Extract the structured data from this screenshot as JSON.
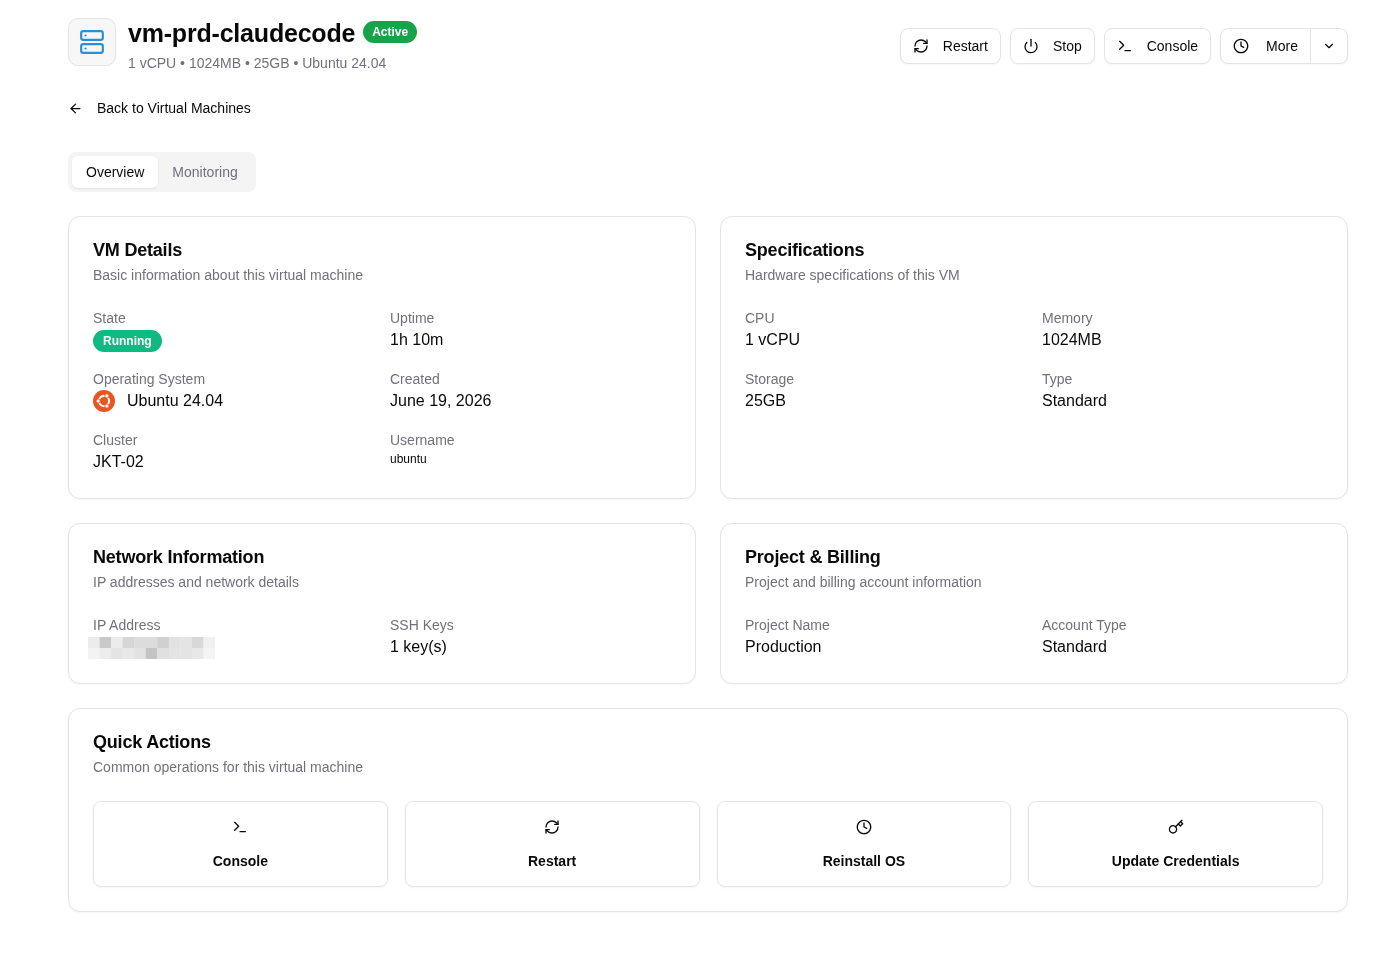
{
  "header": {
    "title": "vm-prd-claudecode",
    "status_badge": "Active",
    "subtitle": "1 vCPU • 1024MB • 25GB • Ubuntu 24.04"
  },
  "actions": [
    {
      "kind": "restart",
      "label": "Restart"
    },
    {
      "kind": "stop",
      "label": "Stop"
    },
    {
      "kind": "console",
      "label": "Console"
    },
    {
      "kind": "more",
      "label": "More"
    }
  ],
  "back_link": "Back to Virtual Machines",
  "tabs": [
    {
      "label": "Overview",
      "selected": true
    },
    {
      "label": "Monitoring",
      "selected": false
    }
  ],
  "cards": [
    {
      "title": "VM Details",
      "description": "Basic information about this virtual machine",
      "fields": [
        {
          "kind": "badge",
          "label": "State",
          "value": "Running"
        },
        {
          "kind": "text",
          "label": "Uptime",
          "value": "1h 10m"
        },
        {
          "kind": "os",
          "label": "Operating System",
          "value": "Ubuntu 24.04"
        },
        {
          "kind": "text",
          "label": "Created",
          "value": "June 19, 2026"
        },
        {
          "kind": "text",
          "label": "Cluster",
          "value": "JKT-02"
        },
        {
          "kind": "small",
          "label": "Username",
          "value": "ubuntu"
        }
      ]
    },
    {
      "title": "Specifications",
      "description": "Hardware specifications of this VM",
      "fields": [
        {
          "kind": "text",
          "label": "CPU",
          "value": "1 vCPU"
        },
        {
          "kind": "text",
          "label": "Memory",
          "value": "1024MB"
        },
        {
          "kind": "text",
          "label": "Storage",
          "value": "25GB"
        },
        {
          "kind": "text",
          "label": "Type",
          "value": "Standard"
        }
      ]
    },
    {
      "title": "Network Information",
      "description": "IP addresses and network details",
      "fields": [
        {
          "kind": "redacted",
          "label": "IP Address"
        },
        {
          "kind": "text",
          "label": "SSH Keys",
          "value": "1 key(s)"
        }
      ]
    },
    {
      "title": "Project & Billing",
      "description": "Project and billing account information",
      "fields": [
        {
          "kind": "text",
          "label": "Project Name",
          "value": "Production"
        },
        {
          "kind": "text",
          "label": "Account Type",
          "value": "Standard"
        }
      ]
    }
  ],
  "quick_actions": {
    "title": "Quick Actions",
    "description": "Common operations for this virtual machine",
    "items": [
      {
        "kind": "console",
        "label": "Console"
      },
      {
        "kind": "restart",
        "label": "Restart"
      },
      {
        "kind": "reinstall",
        "label": "Reinstall OS"
      },
      {
        "kind": "credentials",
        "label": "Update Credentials"
      }
    ]
  }
}
